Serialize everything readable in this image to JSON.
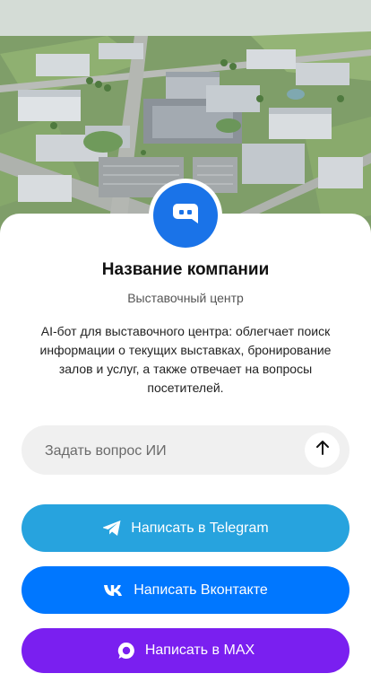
{
  "hero": {
    "image": "aerial-exhibition-center-photo"
  },
  "company": {
    "avatar_icon": "chat-bot-icon",
    "name": "Название компании",
    "type": "Выставочный центр",
    "description": "AI-бот для выставочного центра: облегчает поиск информации о текущих выставках, бронирование залов и услуг, а также отвечает на вопросы посетителей."
  },
  "ask": {
    "placeholder": "Задать вопрос ИИ",
    "send_icon": "arrow-up-icon"
  },
  "actions": {
    "telegram": {
      "label": "Написать в Telegram",
      "icon": "telegram-icon",
      "color": "#27a3de"
    },
    "vk": {
      "label": "Написать Вконтакте",
      "icon": "vk-icon",
      "color": "#0077ff"
    },
    "max": {
      "label": "Написать в MAX",
      "icon": "max-icon",
      "color": "#7a1ff0"
    }
  },
  "colors": {
    "avatar_bg": "#1a73e8",
    "input_bg": "#f0f0f0"
  }
}
